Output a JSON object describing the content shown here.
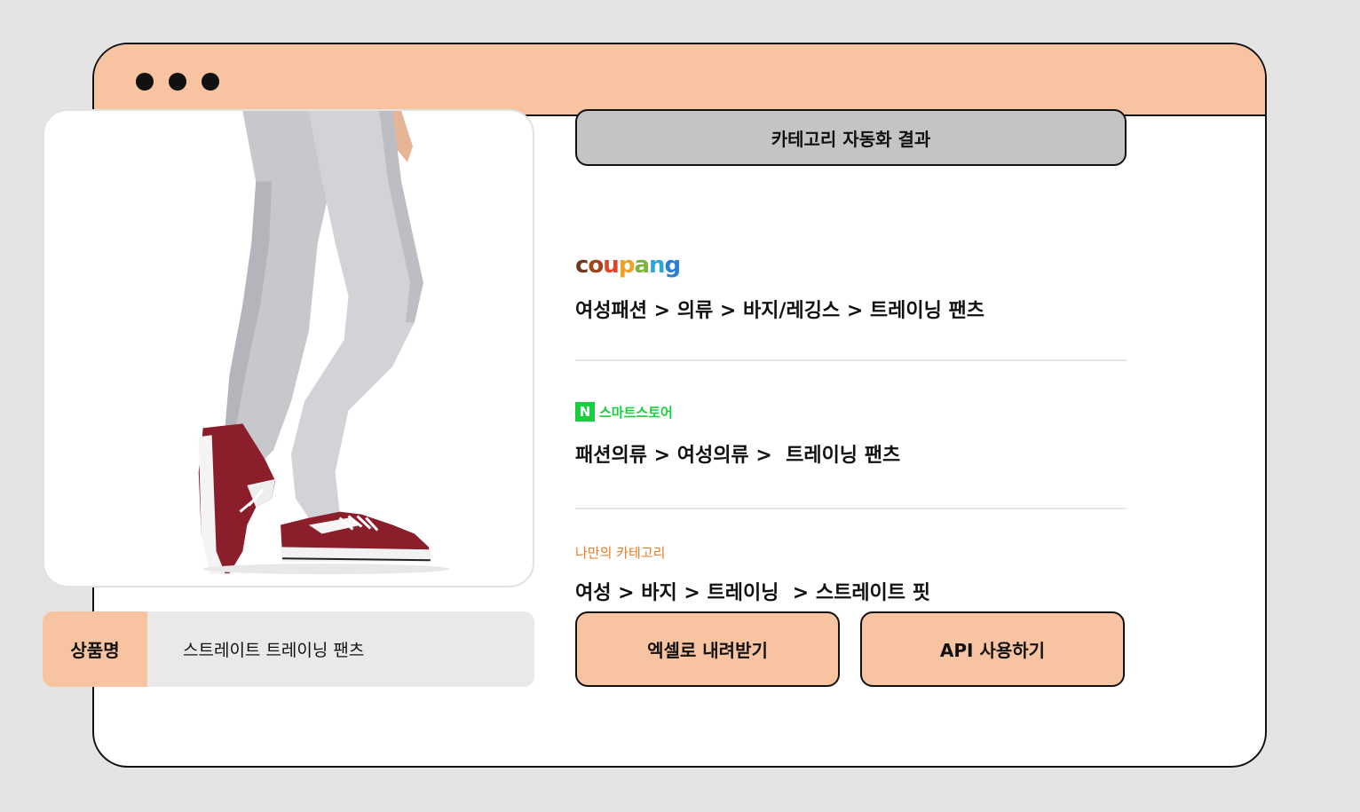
{
  "colors": {
    "background": "#e4e4e4",
    "accent": "#f8c3a1",
    "header_gray": "#c4c4c4",
    "naver_green": "#19ce3c",
    "custom_orange": "#f07a24"
  },
  "window": {
    "controls": [
      "dot",
      "dot",
      "dot"
    ]
  },
  "product": {
    "image_alt_icon": "product-photo-grey-pants-red-sneakers",
    "name_label": "상품명",
    "name_value": "스트레이트 트레이닝 팬츠"
  },
  "results": {
    "header": "카테고리 자동화 결과",
    "coupang": {
      "logo_letters": [
        "c",
        "o",
        "u",
        "p",
        "a",
        "n",
        "g"
      ],
      "logo_colors": [
        "#6e3b1e",
        "#a0441b",
        "#e0452a",
        "#f0a021",
        "#7fb23b",
        "#2ea4dc",
        "#2a7fd4"
      ],
      "path": "여성패션 > 의류 > 바지/레깅스 > 트레이닝 팬츠"
    },
    "naver": {
      "logo_mark": "N",
      "logo_text": "스마트스토어",
      "path": "패션의류 > 여성의류 >  트레이닝 팬츠"
    },
    "custom": {
      "label": "나만의 카테고리",
      "path": "여성 > 바지 > 트레이닝  > 스트레이트 핏"
    }
  },
  "actions": {
    "excel_label": "엑셀로 내려받기",
    "api_label": "API 사용하기"
  }
}
